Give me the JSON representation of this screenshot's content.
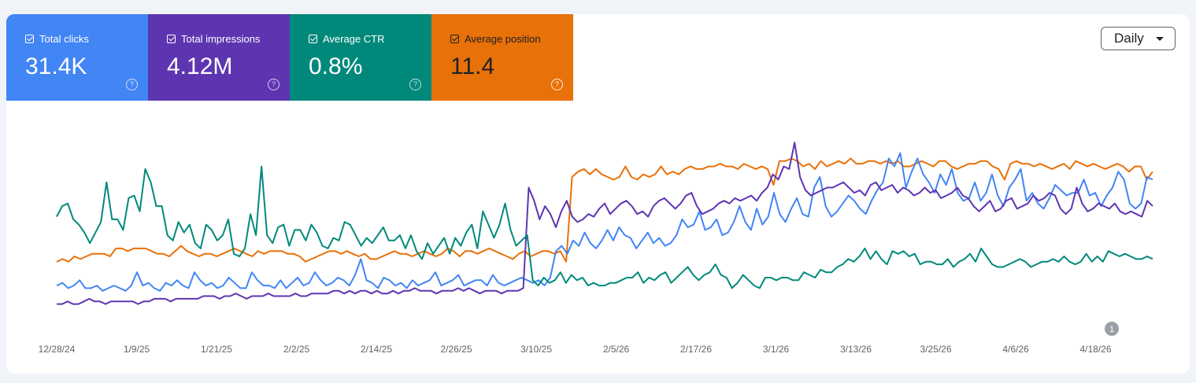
{
  "metrics": [
    {
      "label": "Total clicks",
      "value": "31.4K",
      "color": "#4285f4"
    },
    {
      "label": "Total impressions",
      "value": "4.12M",
      "color": "#5e35b1"
    },
    {
      "label": "Average CTR",
      "value": "0.8%",
      "color": "#00897b"
    },
    {
      "label": "Average position",
      "value": "11.4",
      "color": "#e8710a"
    }
  ],
  "help_glyph": "?",
  "granularity": {
    "selected": "Daily"
  },
  "annotation_marker": "1",
  "chart_data": {
    "type": "line",
    "x_tick_labels": [
      "12/28/24",
      "1/9/25",
      "1/21/25",
      "2/2/25",
      "2/14/25",
      "2/26/25",
      "3/10/25",
      "2/5/26",
      "2/17/26",
      "3/1/26",
      "3/13/26",
      "3/25/26",
      "4/6/26",
      "4/18/26"
    ],
    "legend": "none",
    "y_axis": "hidden",
    "grid": false,
    "series": [
      {
        "color": "#e8710a",
        "values": [
          12,
          13,
          12,
          14,
          13,
          14,
          15,
          15,
          15,
          14,
          17,
          17,
          16,
          17,
          17,
          17,
          16,
          15,
          15,
          14,
          16,
          18,
          16,
          15,
          14,
          15,
          15,
          14,
          15,
          16,
          17,
          16,
          15,
          14,
          16,
          15,
          16,
          16,
          16,
          15,
          15,
          14,
          12,
          13,
          14,
          15,
          16,
          16,
          15,
          16,
          15,
          14,
          15,
          13,
          13,
          14,
          15,
          16,
          15,
          15,
          14,
          15,
          16,
          15,
          14,
          15,
          17,
          16,
          14,
          16,
          16,
          15,
          16,
          17,
          16,
          15,
          14,
          13,
          15,
          16,
          14,
          15,
          16,
          16,
          15,
          16,
          12,
          44,
          46,
          47,
          45,
          47,
          45,
          44,
          43,
          44,
          48,
          44,
          43,
          45,
          44,
          45,
          48,
          45,
          46,
          45,
          47,
          48,
          47,
          47,
          48,
          48,
          49,
          48,
          48,
          47,
          49,
          48,
          47,
          48,
          47,
          41,
          50,
          50,
          51,
          50,
          48,
          49,
          47,
          50,
          48,
          49,
          50,
          49,
          51,
          49,
          49,
          50,
          50,
          49,
          50,
          49,
          50,
          48,
          48,
          49,
          50,
          49,
          48,
          50,
          50,
          48,
          47,
          48,
          49,
          49,
          50,
          50,
          48,
          47,
          43,
          49,
          50,
          49,
          49,
          48,
          49,
          48,
          47,
          48,
          49,
          47,
          50,
          49,
          48,
          49,
          48,
          47,
          48,
          49,
          48,
          46,
          48,
          48,
          43,
          46
        ]
      },
      {
        "color": "#4285f4",
        "values": [
          3,
          4,
          2,
          3,
          5,
          2,
          2,
          3,
          1,
          2,
          3,
          2,
          1,
          3,
          8,
          3,
          4,
          2,
          1,
          4,
          3,
          5,
          3,
          2,
          8,
          5,
          3,
          4,
          2,
          3,
          6,
          4,
          2,
          2,
          8,
          5,
          3,
          3,
          2,
          5,
          2,
          4,
          6,
          3,
          4,
          8,
          5,
          3,
          4,
          6,
          5,
          3,
          7,
          13,
          5,
          4,
          2,
          6,
          5,
          3,
          4,
          2,
          5,
          3,
          4,
          5,
          8,
          3,
          4,
          5,
          7,
          3,
          4,
          5,
          5,
          3,
          7,
          4,
          3,
          4,
          5,
          6,
          5,
          4,
          5,
          3,
          6,
          16,
          18,
          15,
          20,
          18,
          23,
          19,
          17,
          20,
          24,
          20,
          25,
          22,
          21,
          17,
          20,
          23,
          19,
          21,
          18,
          19,
          22,
          28,
          25,
          26,
          31,
          24,
          25,
          28,
          22,
          23,
          27,
          33,
          27,
          24,
          32,
          26,
          29,
          38,
          30,
          27,
          32,
          36,
          30,
          29,
          40,
          44,
          33,
          29,
          31,
          34,
          37,
          35,
          32,
          30,
          35,
          39,
          42,
          51,
          48,
          53,
          40,
          46,
          51,
          45,
          42,
          38,
          45,
          41,
          47,
          38,
          35,
          36,
          42,
          35,
          38,
          45,
          37,
          33,
          40,
          43,
          47,
          35,
          38,
          34,
          32,
          36,
          41,
          39,
          37,
          38,
          38,
          43,
          37,
          38,
          33,
          37,
          40,
          46,
          43,
          34,
          32,
          34,
          44,
          43
        ]
      },
      {
        "color": "#5e35b1",
        "values": [
          -4,
          -4,
          -3,
          -4,
          -4,
          -3,
          -2,
          -3,
          -3,
          -4,
          -3,
          -3,
          -3,
          -3,
          -3,
          -4,
          -3,
          -3,
          -2,
          -2,
          -2,
          -3,
          -2,
          -2,
          -2,
          -2,
          -2,
          -1,
          -1,
          -1,
          -2,
          -1,
          -1,
          0,
          -1,
          -2,
          -1,
          -1,
          -1,
          0,
          -1,
          -1,
          -1,
          -1,
          0,
          -1,
          -1,
          0,
          0,
          0,
          0,
          1,
          1,
          0,
          1,
          0,
          1,
          1,
          0,
          1,
          0,
          0,
          1,
          0,
          1,
          1,
          2,
          1,
          1,
          1,
          0,
          1,
          1,
          1,
          2,
          1,
          2,
          1,
          0,
          1,
          1,
          1,
          0,
          1,
          1,
          1,
          2,
          40,
          35,
          28,
          33,
          30,
          25,
          31,
          35,
          29,
          27,
          28,
          30,
          29,
          32,
          34,
          30,
          32,
          34,
          35,
          33,
          30,
          31,
          29,
          33,
          35,
          36,
          34,
          32,
          34,
          37,
          38,
          33,
          30,
          31,
          32,
          34,
          35,
          34,
          36,
          35,
          36,
          37,
          35,
          38,
          40,
          45,
          43,
          48,
          47,
          57,
          44,
          39,
          37,
          38,
          39,
          40,
          40,
          41,
          42,
          40,
          38,
          39,
          37,
          41,
          42,
          39,
          40,
          41,
          38,
          40,
          39,
          37,
          38,
          40,
          38,
          39,
          36,
          37,
          38,
          40,
          37,
          36,
          33,
          31,
          33,
          35,
          31,
          32,
          35,
          36,
          32,
          33,
          34,
          37,
          35,
          36,
          38,
          37,
          32,
          30,
          32,
          40,
          34,
          31,
          32,
          34,
          33,
          32,
          34,
          31,
          30,
          31,
          30,
          29,
          35,
          33
        ]
      },
      {
        "color": "#00897b",
        "values": [
          29,
          33,
          34,
          28,
          26,
          23,
          19,
          23,
          27,
          42,
          28,
          28,
          24,
          36,
          37,
          31,
          47,
          42,
          33,
          33,
          22,
          20,
          27,
          23,
          26,
          19,
          17,
          26,
          24,
          20,
          22,
          28,
          15,
          14,
          17,
          30,
          22,
          48,
          22,
          19,
          25,
          26,
          18,
          24,
          24,
          20,
          26,
          23,
          18,
          17,
          21,
          20,
          27,
          26,
          22,
          18,
          21,
          19,
          22,
          25,
          20,
          20,
          22,
          17,
          22,
          16,
          13,
          19,
          15,
          18,
          21,
          15,
          21,
          18,
          23,
          26,
          17,
          31,
          26,
          21,
          26,
          34,
          24,
          18,
          20,
          22,
          5,
          3,
          6,
          4,
          5,
          8,
          4,
          7,
          5,
          6,
          3,
          4,
          3,
          3,
          4,
          4,
          5,
          6,
          6,
          8,
          4,
          6,
          5,
          7,
          8,
          4,
          6,
          8,
          10,
          7,
          5,
          7,
          8,
          11,
          7,
          6,
          2,
          4,
          7,
          5,
          3,
          2,
          6,
          6,
          5,
          6,
          6,
          5,
          5,
          8,
          7,
          6,
          9,
          8,
          8,
          10,
          11,
          13,
          12,
          14,
          17,
          13,
          16,
          13,
          11,
          16,
          15,
          16,
          14,
          15,
          11,
          12,
          12,
          11,
          11,
          13,
          10,
          12,
          13,
          15,
          12,
          17,
          14,
          11,
          10,
          10,
          11,
          12,
          13,
          12,
          10,
          11,
          12,
          12,
          13,
          12,
          14,
          12,
          11,
          12,
          15,
          12,
          14,
          12,
          16,
          15,
          14,
          15,
          14,
          13,
          13,
          14,
          13
        ]
      }
    ]
  }
}
